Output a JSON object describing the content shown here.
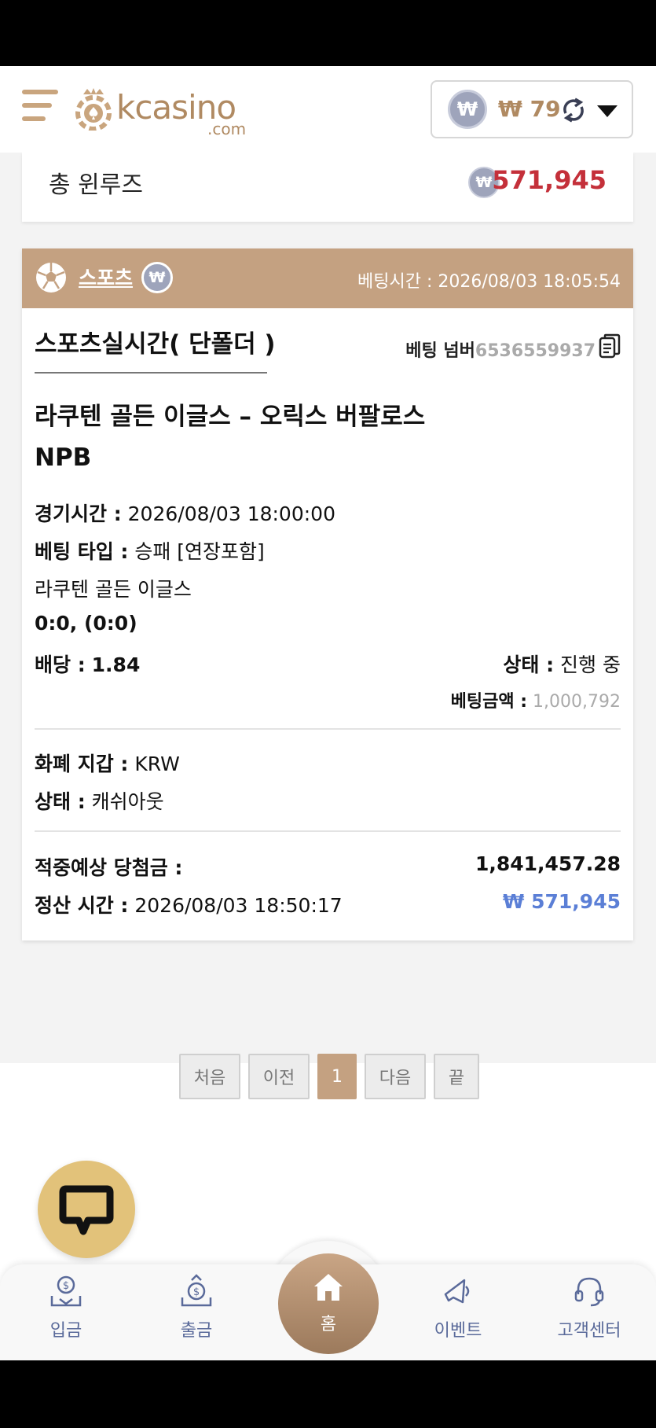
{
  "header": {
    "logo_text": "kcasino",
    "logo_suffix": ".com",
    "currency_symbol": "₩",
    "balance": "₩ 79"
  },
  "summary": {
    "label": "총 윈루즈",
    "currency_symbol": "₩",
    "value": "571,945"
  },
  "bet": {
    "category": "스포츠",
    "currency_symbol": "₩",
    "bet_time": "베팅시간 : 2026/08/03 18:05:54",
    "title": "스포츠실시간( 단폴더 )",
    "bet_number_label": "베팅 넘버",
    "bet_number": "6536559937",
    "match": "라쿠텐 골든 이글스 – 오릭스 버팔로스",
    "league": "NPB",
    "game_time_label": "경기시간 :",
    "game_time": "2026/08/03 18:00:00",
    "bet_type_label": "베팅 타입 :",
    "bet_type": "승패 [연장포함]",
    "pick": "라쿠텐 골든 이글스",
    "score": "0:0, (0:0)",
    "odds_label": "배당 :",
    "odds": "1.84",
    "status_label": "상태 :",
    "status": "진행 중",
    "amount_label": "베팅금액 :",
    "amount": "1,000,792",
    "wallet_label": "화폐 지갑 :",
    "wallet": "KRW",
    "state_label": "상태 :",
    "state": "캐쉬아웃",
    "expected_label": "적중예상 당첨금 :",
    "expected": "1,841,457.28",
    "settle_label": "정산 시간 :",
    "settle_time": "2026/08/03 18:50:17",
    "payout": "₩ 571,945"
  },
  "pagination": {
    "first": "처음",
    "prev": "이전",
    "current": "1",
    "next": "다음",
    "last": "끝"
  },
  "nav": {
    "deposit": "입금",
    "withdraw": "출금",
    "home": "홈",
    "event": "이벤트",
    "support": "고객센터"
  },
  "colors": {
    "brand": "#c4a181",
    "accent_red": "#c4303a",
    "payout_blue": "#5b7fd6",
    "chat": "#e2c27a"
  }
}
